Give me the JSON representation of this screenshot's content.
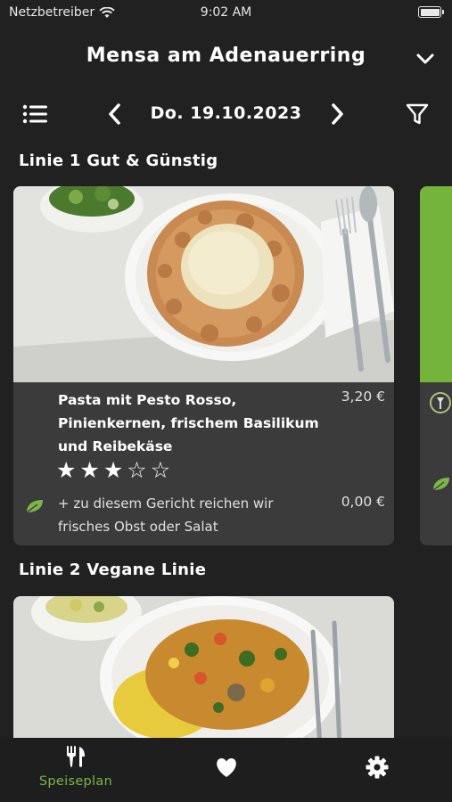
{
  "status_bar": {
    "carrier": "Netzbetreiber",
    "time": "9:02 AM"
  },
  "header": {
    "title": "Mensa am Adenauerring"
  },
  "date_nav": {
    "date": "Do. 19.10.2023"
  },
  "lines": [
    {
      "title": "Linie 1 Gut & Günstig",
      "meal": {
        "name": "Pasta mit Pesto Rosso, Pinienkernen, frischem Basilikum und Reibekäse",
        "price": "3,20 €",
        "rating": 3,
        "rating_max": 5,
        "stars_text": "★★★☆☆"
      },
      "side": {
        "text": "+ zu diesem Gericht reichen wir frisches Obst oder Salat",
        "price": "0,00 €"
      }
    },
    {
      "title": "Linie 2 Vegane Linie"
    }
  ],
  "bottom_nav": {
    "tabs": [
      {
        "label": "Speiseplan",
        "icon": "cutlery-icon",
        "active": true
      },
      {
        "label": "",
        "icon": "heart-icon"
      },
      {
        "label": "",
        "icon": "gear-icon"
      }
    ]
  },
  "colors": {
    "background": "#212121",
    "card": "#3b3b3b",
    "accent": "#7ab648"
  }
}
